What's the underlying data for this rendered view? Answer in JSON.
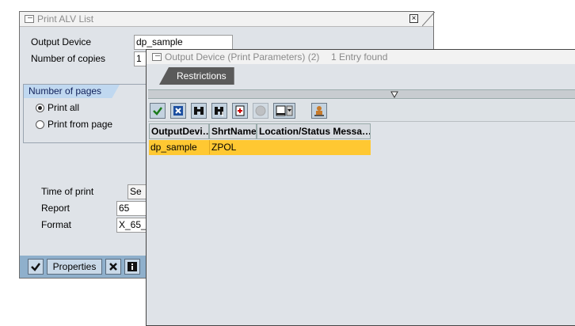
{
  "print_dialog": {
    "title": "Print ALV List",
    "output_device_label": "Output Device",
    "output_device_value": "dp_sample",
    "copies_label": "Number of copies",
    "copies_value": "1",
    "pages_group_title": "Number of pages",
    "print_all_label": "Print all",
    "print_from_label": "Print from page",
    "time_label": "Time of print",
    "time_value": "Se",
    "report_label": "Report",
    "report_value": "65",
    "format_label": "Format",
    "format_value": "X_65_",
    "properties_label": "Properties"
  },
  "output_dialog": {
    "title": "Output Device (Print Parameters) (2)",
    "entries_found": "1 Entry found",
    "tab_restrictions": "Restrictions",
    "columns": [
      "OutputDevi…",
      "ShrtName",
      "Location/Status Messa…"
    ],
    "rows": [
      {
        "device": "dp_sample",
        "short_name": "ZPOL",
        "location": ""
      }
    ],
    "highlight_color": "#ffc832"
  }
}
